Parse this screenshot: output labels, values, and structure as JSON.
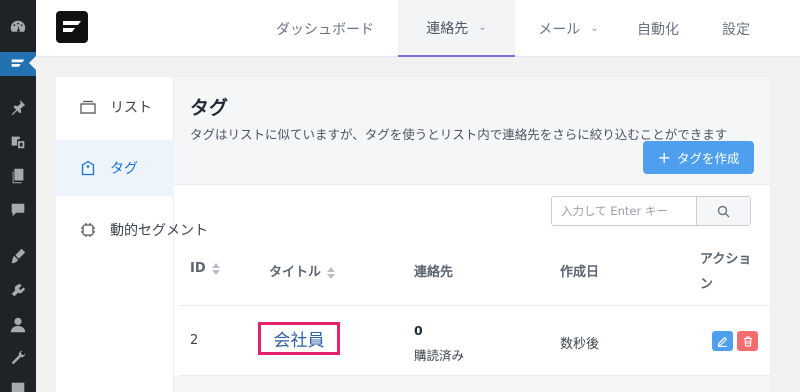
{
  "wp_menu": {
    "icons": [
      "dashboard-icon",
      "fluentcrm-icon",
      "pin-icon",
      "media-icon",
      "pages-icon",
      "comments-icon",
      "appearance-icon",
      "plugins-icon",
      "users-icon",
      "tools-icon",
      "settings-icon"
    ]
  },
  "nav": {
    "items": [
      {
        "label": "ダッシュボード"
      },
      {
        "label": "連絡先",
        "active": true
      },
      {
        "label": "メール"
      },
      {
        "label": "自動化"
      },
      {
        "label": "設定"
      }
    ]
  },
  "sidebar": {
    "items": [
      {
        "label": "リスト",
        "icon": "list-icon"
      },
      {
        "label": "タグ",
        "icon": "tag-icon",
        "active": true
      },
      {
        "label": "動的セグメント",
        "icon": "chip-icon"
      }
    ]
  },
  "page": {
    "title": "タグ",
    "description": "タグはリストに似ていますが、タグを使うとリスト内で連絡先をさらに絞り込むことができます",
    "create_button": "タグを作成"
  },
  "search": {
    "placeholder": "入力して Enter キー"
  },
  "table": {
    "columns": [
      "ID",
      "タイトル",
      "連絡先",
      "作成日",
      "アクション"
    ],
    "rows": [
      {
        "id": "2",
        "title": "会社員",
        "count": "0",
        "count_label": "購読済み",
        "created": "数秒後"
      }
    ]
  },
  "colors": {
    "primary": "#4ea0ef",
    "danger": "#f26d6d",
    "highlight_border": "#e6216b",
    "nav_active_underline": "#7c6fd6"
  }
}
